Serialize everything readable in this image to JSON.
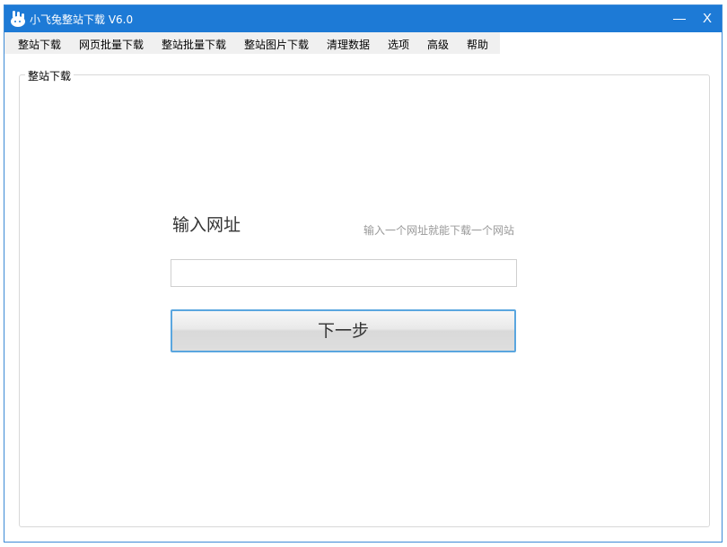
{
  "window": {
    "title": "小飞兔整站下载 V6.0",
    "app_icon": "rabbit-logo-icon",
    "minimize_icon": "minimize-icon",
    "close_label": "X"
  },
  "menu": {
    "items": [
      {
        "label": "整站下载"
      },
      {
        "label": "网页批量下载"
      },
      {
        "label": "整站批量下载"
      },
      {
        "label": "整站图片下载"
      },
      {
        "label": "清理数据"
      },
      {
        "label": "选项"
      },
      {
        "label": "高级"
      },
      {
        "label": "帮助"
      }
    ]
  },
  "main": {
    "group_title": "整站下载",
    "url_heading": "输入网址",
    "url_hint": "输入一个网址就能下载一个网站",
    "url_input_value": "",
    "next_button_label": "下一步"
  },
  "colors": {
    "titlebar": "#1d7ad6",
    "menubar": "#f0f0f0",
    "button_border": "#5aa6df"
  }
}
